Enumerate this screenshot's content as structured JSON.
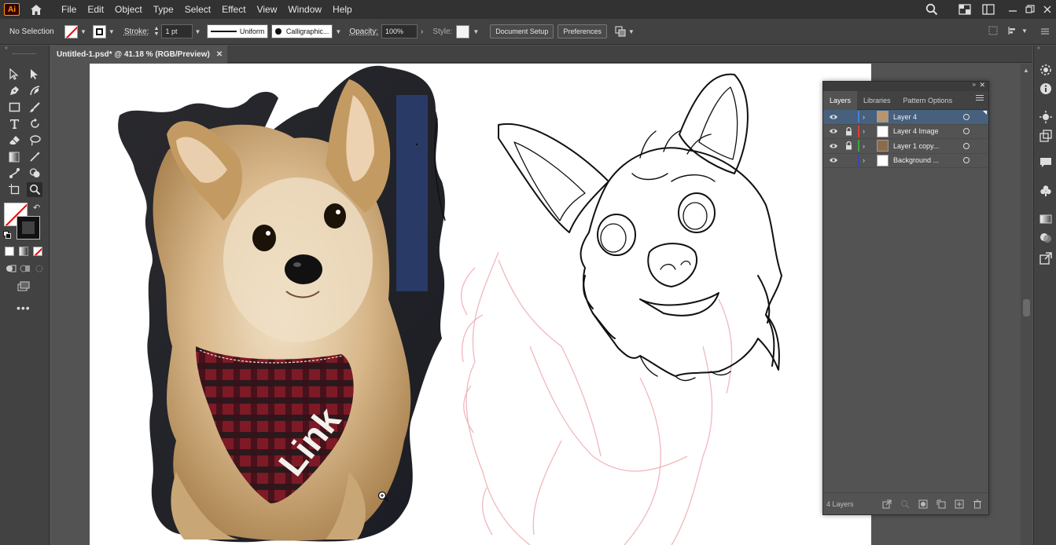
{
  "app": {
    "logo_text": "Ai",
    "menu": [
      "File",
      "Edit",
      "Object",
      "Type",
      "Select",
      "Effect",
      "View",
      "Window",
      "Help"
    ]
  },
  "controlbar": {
    "selection_status": "No Selection",
    "stroke_label": "Stroke:",
    "stroke_weight": "1 pt",
    "stroke_profile": "Uniform",
    "brush_name": "Calligraphic...",
    "opacity_label": "Opacity:",
    "opacity_value": "100%",
    "style_label": "Style:",
    "document_setup_button": "Document Setup",
    "preferences_button": "Preferences"
  },
  "document": {
    "tab_title": "Untitled-1.psd* @ 41.18 % (RGB/Preview)",
    "zoom_percent": 41.18,
    "color_mode": "RGB/Preview"
  },
  "artwork": {
    "bandana_text": "Link",
    "sketch_color": "#f0b8bd",
    "bandana_color": "#8b1e2b"
  },
  "layers_panel": {
    "tabs": [
      "Layers",
      "Libraries",
      "Pattern Options"
    ],
    "active_tab": "Layers",
    "layers": [
      {
        "name": "Layer 4",
        "color": "#4a7fd6",
        "locked": false,
        "visible": true,
        "selected": true,
        "thumb": "photo"
      },
      {
        "name": "Layer 4 Image",
        "color": "#e53935",
        "locked": true,
        "visible": true,
        "selected": false,
        "thumb": "blank"
      },
      {
        "name": "Layer 1 copy...",
        "color": "#43a047",
        "locked": true,
        "visible": true,
        "selected": false,
        "thumb": "photo"
      },
      {
        "name": "Background ...",
        "color": "#3949ab",
        "locked": false,
        "visible": true,
        "selected": false,
        "thumb": "blank"
      }
    ],
    "layer_count": "4 Layers"
  },
  "colors": {
    "ui_dark": "#323232",
    "ui_panel": "#424242",
    "ui_bg": "#535353",
    "selection": "#46607d",
    "accent_orange": "#ff9a00"
  }
}
